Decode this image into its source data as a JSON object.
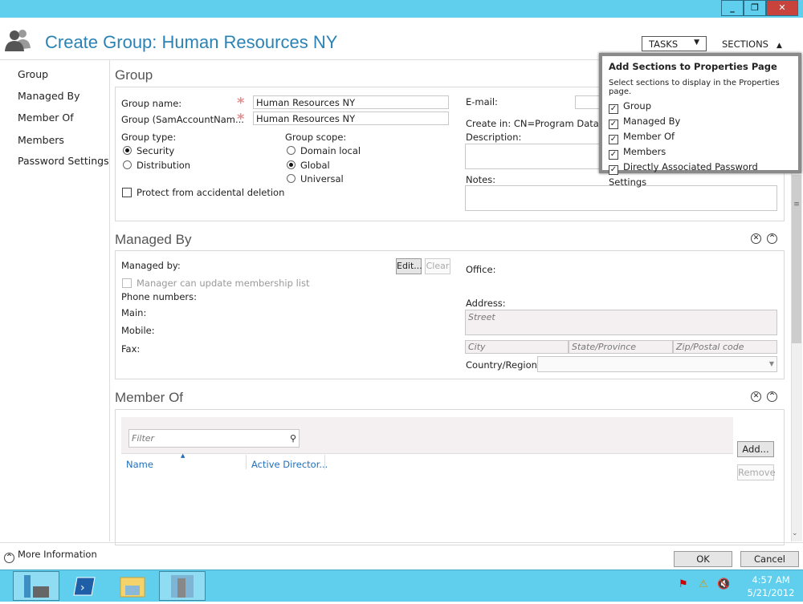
{
  "window": {
    "title": "Create Group: Human Resources NY",
    "controls": [
      "minimize",
      "restore",
      "close"
    ]
  },
  "header": {
    "tasks_label": "TASKS",
    "sections_label": "SECTIONS"
  },
  "nav": {
    "items": [
      "Group",
      "Managed By",
      "Member Of",
      "Members",
      "Password Settings"
    ]
  },
  "group": {
    "heading": "Group",
    "group_name_label": "Group name:",
    "group_name_value": "Human Resources NY",
    "sam_label": "Group (SamAccountNam...",
    "sam_value": "Human Resources NY",
    "type_label": "Group type:",
    "type_options": [
      "Security",
      "Distribution"
    ],
    "type_selected": "Security",
    "scope_label": "Group scope:",
    "scope_options": [
      "Domain local",
      "Global",
      "Universal"
    ],
    "scope_selected": "Global",
    "protect_label": "Protect from accidental deletion",
    "protect_checked": false,
    "email_label": "E-mail:",
    "create_in_label": "Create in:",
    "create_in_value": "CN=Program Data,DC",
    "description_label": "Description:",
    "notes_label": "Notes:"
  },
  "managed_by": {
    "heading": "Managed By",
    "managed_by_label": "Managed by:",
    "edit_label": "Edit...",
    "clear_label": "Clear",
    "manager_update_label": "Manager can update membership list",
    "phone_label": "Phone numbers:",
    "main_label": "Main:",
    "mobile_label": "Mobile:",
    "fax_label": "Fax:",
    "office_label": "Office:",
    "address_label": "Address:",
    "street_placeholder": "Street",
    "city_placeholder": "City",
    "state_placeholder": "State/Province",
    "zip_placeholder": "Zip/Postal code",
    "country_label": "Country/Region:"
  },
  "member_of": {
    "heading": "Member Of",
    "filter_placeholder": "Filter",
    "columns": [
      "Name",
      "Active Director..."
    ],
    "add_label": "Add...",
    "remove_label": "Remove"
  },
  "popup": {
    "title": "Add Sections to Properties Page",
    "subtitle": "Select sections to display in the Properties page.",
    "items": [
      {
        "label": "Group",
        "checked": true
      },
      {
        "label": "Managed By",
        "checked": true
      },
      {
        "label": "Member Of",
        "checked": true
      },
      {
        "label": "Members",
        "checked": true
      },
      {
        "label": "Directly Associated Password Settings",
        "checked": true
      }
    ]
  },
  "footer": {
    "more_info": "More Information",
    "ok": "OK",
    "cancel": "Cancel"
  },
  "taskbar": {
    "apps": [
      "server-manager",
      "powershell",
      "file-explorer",
      "active-directory-admin-center"
    ],
    "time": "4:57 AM",
    "date": "5/21/2012",
    "tray": [
      "action-center-flag",
      "network-warning",
      "volume-muted"
    ]
  },
  "colors": {
    "titlebar": "#5fcfed",
    "title_text": "#2a83b4",
    "link": "#1f6fbf",
    "required": "#e78d8d"
  }
}
